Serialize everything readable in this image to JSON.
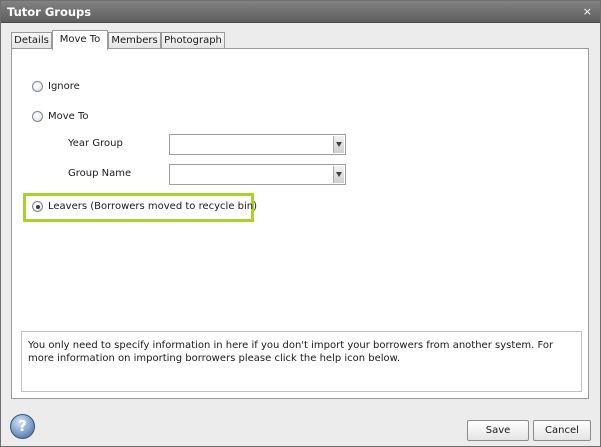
{
  "window": {
    "title": "Tutor Groups",
    "close_glyph": "×"
  },
  "tabs": [
    {
      "label": "Details",
      "active": false
    },
    {
      "label": "Move To",
      "active": true
    },
    {
      "label": "Members",
      "active": false
    },
    {
      "label": "Photograph",
      "active": false
    }
  ],
  "options": {
    "ignore": {
      "label": "Ignore",
      "checked": false
    },
    "move_to": {
      "label": "Move To",
      "checked": false
    },
    "leavers": {
      "label": "Leavers (Borrowers moved to recycle bin)",
      "checked": true
    }
  },
  "fields": {
    "year_group": {
      "label": "Year Group",
      "value": ""
    },
    "group_name": {
      "label": "Group Name",
      "value": ""
    }
  },
  "info_text": "You only need to specify information in here if you don't import your borrowers from another system. For more information on importing borrowers please click the help icon below.",
  "buttons": {
    "save": "Save",
    "cancel": "Cancel",
    "help_glyph": "?"
  },
  "colors": {
    "highlight": "#a7d32c",
    "titlebar": "#6b6b6b",
    "help": "#5b84b8"
  },
  "icons": [
    "close-icon",
    "help-icon",
    "dropdown-arrow-icon"
  ]
}
